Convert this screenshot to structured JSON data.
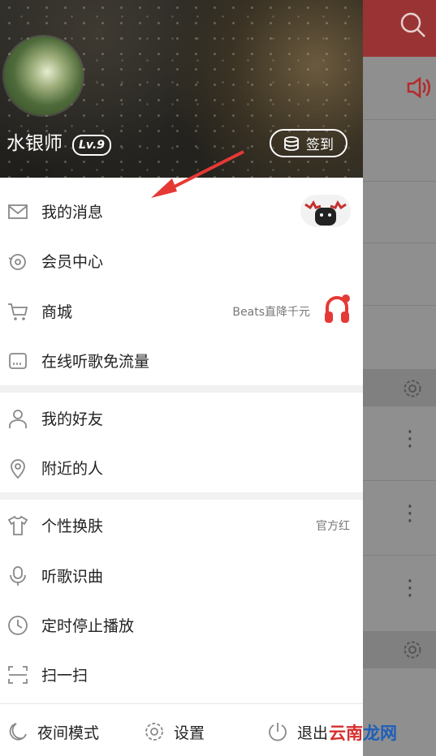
{
  "app": {
    "header": {
      "username": "水银师",
      "level": "Lv.9",
      "checkin_label": "签到"
    },
    "menu_group1": [
      {
        "label": "我的消息",
        "icon": "mail-icon",
        "extra": ""
      },
      {
        "label": "会员中心",
        "icon": "vip-disc-icon",
        "extra": ""
      },
      {
        "label": "商城",
        "icon": "cart-icon",
        "extra": "Beats直降千元"
      },
      {
        "label": "在线听歌免流量",
        "icon": "sim-card-icon",
        "extra": ""
      }
    ],
    "menu_group2": [
      {
        "label": "我的好友",
        "icon": "person-icon",
        "extra": ""
      },
      {
        "label": "附近的人",
        "icon": "location-pin-icon",
        "extra": ""
      }
    ],
    "menu_group3": [
      {
        "label": "个性换肤",
        "icon": "tshirt-icon",
        "extra": "官方红"
      },
      {
        "label": "听歌识曲",
        "icon": "mic-icon",
        "extra": ""
      },
      {
        "label": "定时停止播放",
        "icon": "clock-icon",
        "extra": ""
      },
      {
        "label": "扫一扫",
        "icon": "scan-icon",
        "extra": ""
      }
    ],
    "bottom_bar": {
      "night_mode": "夜间模式",
      "settings": "设置",
      "exit": "退出"
    },
    "watermark": {
      "part1": "云南",
      "part2": "龙网"
    },
    "colors": {
      "brand_red": "#c62f2f",
      "headphones_red": "#e53935",
      "overlay_gray": "#8f8f8f"
    }
  }
}
